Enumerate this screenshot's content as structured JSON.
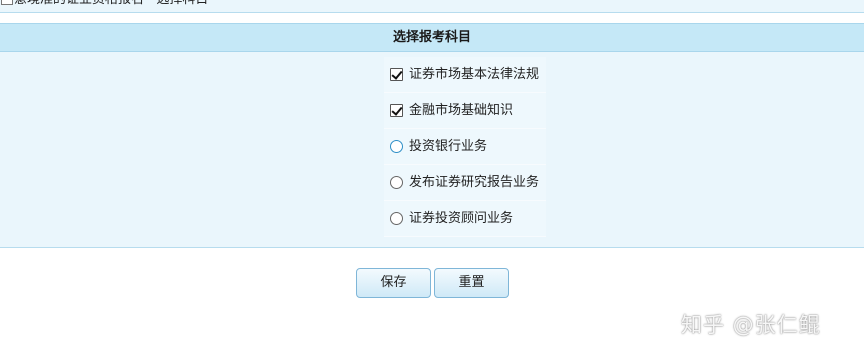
{
  "breadcrumb": {
    "text": "意境准的证业资格报名 · 选择科目"
  },
  "section": {
    "title": "选择报考科目"
  },
  "options": [
    {
      "label": "证券市场基本法律法规",
      "type": "checkbox",
      "checked": true
    },
    {
      "label": "金融市场基础知识",
      "type": "checkbox",
      "checked": true
    },
    {
      "label": "投资银行业务",
      "type": "radio",
      "checked": false,
      "state": "hover"
    },
    {
      "label": "发布证券研究报告业务",
      "type": "radio",
      "checked": false
    },
    {
      "label": "证券投资顾问业务",
      "type": "radio",
      "checked": false
    }
  ],
  "actions": {
    "save_label": "保存",
    "reset_label": "重置"
  },
  "watermark": {
    "text": "知乎 @张仁鲲"
  },
  "colors": {
    "header_bg": "#c5e8f7",
    "panel_bg": "#eaf6fc",
    "button_border": "#7fb6d8",
    "radio_hover": "#2f8fc7"
  },
  "icons": {
    "checkbox_checked": "checkbox-checked-icon",
    "radio_unchecked": "radio-unchecked-icon",
    "breadcrumb": "page-icon"
  }
}
